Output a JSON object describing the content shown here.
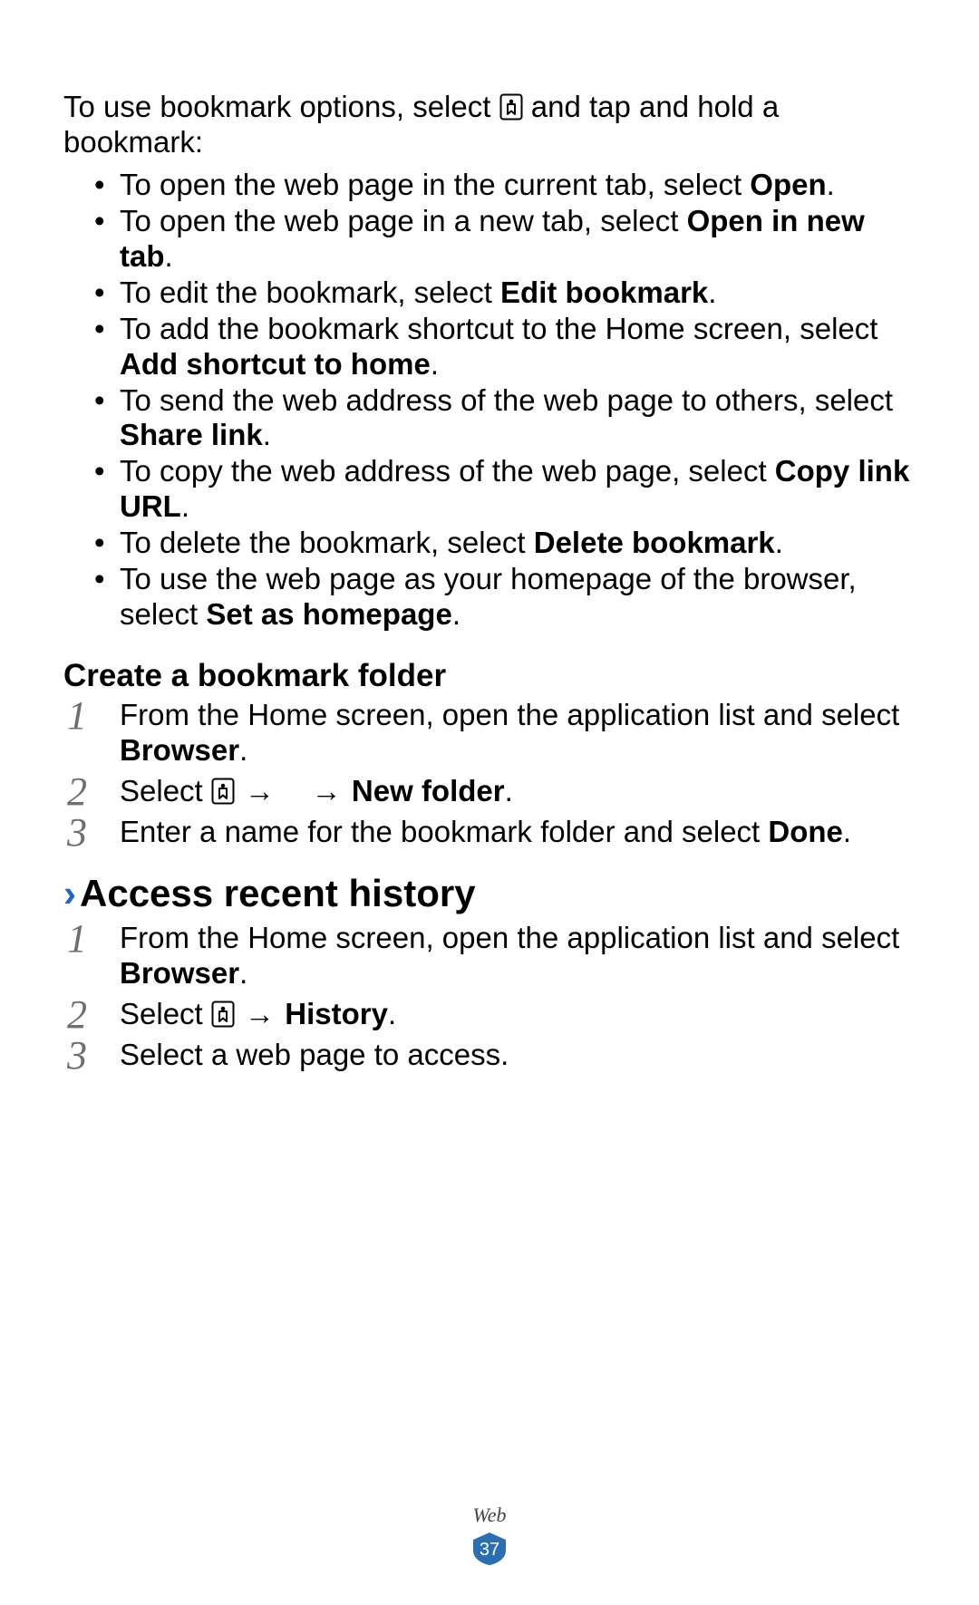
{
  "intro": {
    "pre": "To use bookmark options, select ",
    "post": " and tap and hold a bookmark:"
  },
  "bullets": [
    {
      "pre": "To open the web page in the current tab, select ",
      "bold": "Open",
      "post": "."
    },
    {
      "pre": "To open the web page in a new tab, select ",
      "bold": "Open in new tab",
      "post": "."
    },
    {
      "pre": "To edit the bookmark, select ",
      "bold": "Edit bookmark",
      "post": "."
    },
    {
      "pre": "To add the bookmark shortcut to the Home screen, select ",
      "bold": "Add shortcut to home",
      "post": "."
    },
    {
      "pre": "To send the web address of the web page to others, select ",
      "bold": "Share link",
      "post": "."
    },
    {
      "pre": "To copy the web address of the web page, select ",
      "bold": "Copy link URL",
      "post": "."
    },
    {
      "pre": "To delete the bookmark, select ",
      "bold": "Delete bookmark",
      "post": "."
    },
    {
      "pre": "To use the web page as your homepage of the browser, select ",
      "bold": "Set as homepage",
      "post": "."
    }
  ],
  "createFolder": {
    "heading": "Create a bookmark folder",
    "steps": {
      "s1_pre": "From the Home screen, open the application list and select ",
      "s1_bold": "Browser",
      "s1_post": ".",
      "s2_pre": "Select ",
      "s2_arrow1": " → ",
      "s2_arrow2": " → ",
      "s2_bold": "New folder",
      "s2_post": ".",
      "s3_pre": "Enter a name for the bookmark folder and select ",
      "s3_bold": "Done",
      "s3_post": "."
    }
  },
  "history": {
    "heading": "Access recent history",
    "steps": {
      "s1_pre": "From the Home screen, open the application list and select ",
      "s1_bold": "Browser",
      "s1_post": ".",
      "s2_pre": "Select ",
      "s2_arrow": " → ",
      "s2_bold": "History",
      "s2_post": ".",
      "s3": "Select a web page to access."
    }
  },
  "footer": {
    "label": "Web",
    "page": "37"
  }
}
